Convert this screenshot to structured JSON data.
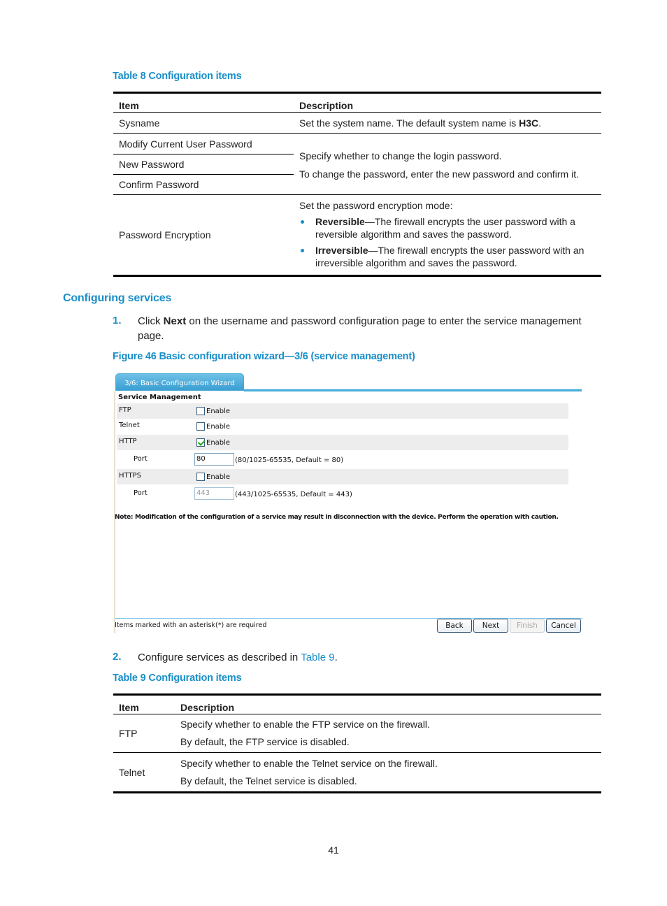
{
  "table8": {
    "caption": "Table 8 Configuration items",
    "headers": [
      "Item",
      "Description"
    ],
    "rows": [
      {
        "item": "Sysname",
        "desc_pre": "Set the system name. The default system name is ",
        "desc_bold": "H3C",
        "desc_post": "."
      },
      {
        "item": "Modify Current User Password"
      },
      {
        "item": "New Password"
      },
      {
        "item": "Confirm Password"
      },
      {
        "item": "Password Encryption"
      }
    ],
    "password_desc": [
      "Specify whether to change the login password.",
      "To change the password, enter the new password and confirm it."
    ],
    "encryption": {
      "intro": "Set the password encryption mode:",
      "bullets": [
        {
          "term": "Reversible",
          "text": "—The firewall encrypts the user password with a reversible algorithm and saves the password."
        },
        {
          "term": "Irreversible",
          "text": "—The firewall encrypts the user password with an irreversible algorithm and saves the password."
        }
      ]
    }
  },
  "section": {
    "heading": "Configuring services",
    "step1": {
      "num": "1.",
      "pre": "Click ",
      "bold": "Next",
      "post": " on the username and password configuration page to enter the service management page."
    },
    "figure_caption": "Figure 46 Basic configuration wizard—3/6 (service management)",
    "step2": {
      "num": "2.",
      "pre": "Configure services as described in ",
      "link": "Table 9",
      "post": "."
    }
  },
  "wizard": {
    "tab_label": "3/6: Basic Configuration Wizard",
    "title": "Service Management",
    "ftp": {
      "label": "FTP",
      "checkbox_label": "Enable",
      "checked": false
    },
    "telnet": {
      "label": "Telnet",
      "checkbox_label": "Enable",
      "checked": false
    },
    "http": {
      "label": "HTTP",
      "checkbox_label": "Enable",
      "checked": true,
      "port_label": "Port",
      "port_value": "80",
      "port_hint": "(80/1025-65535, Default = 80)"
    },
    "https": {
      "label": "HTTPS",
      "checkbox_label": "Enable",
      "checked": false,
      "port_label": "Port",
      "port_value": "443",
      "port_hint": "(443/1025-65535, Default = 443)"
    },
    "note": "Note: Modification of the configuration of a service may result in disconnection with the device. Perform the operation with caution.",
    "required_note": "Items marked with an asterisk(*) are required",
    "buttons": {
      "back": "Back",
      "next": "Next",
      "finish": "Finish",
      "cancel": "Cancel"
    }
  },
  "table9": {
    "caption": "Table 9 Configuration items",
    "headers": [
      "Item",
      "Description"
    ],
    "rows": [
      {
        "item": "FTP",
        "lines": [
          "Specify whether to enable the FTP service on the firewall.",
          "By default, the FTP service is disabled."
        ]
      },
      {
        "item": "Telnet",
        "lines": [
          "Specify whether to enable the Telnet service on the firewall.",
          "By default, the Telnet service is disabled."
        ]
      }
    ]
  },
  "page_number": "41"
}
